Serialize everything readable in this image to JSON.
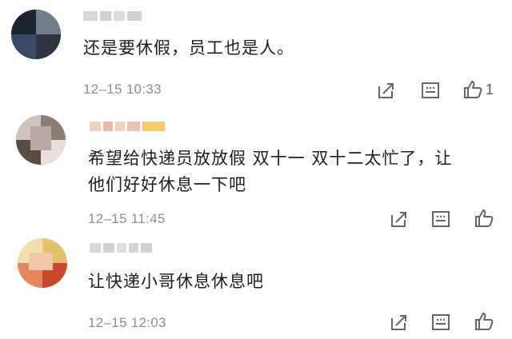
{
  "comments": [
    {
      "username": "",
      "text": "还是要休假，员工也是人。",
      "time": "12–15 10:33",
      "likes": "1",
      "avatar_colors": [
        "#2f3440",
        "#1b2330",
        "#6f7c8c",
        "#3a4a66"
      ]
    },
    {
      "username": "",
      "text_line1": "希望给快递员放放假   双十一   双十二太忙了，让",
      "text_line2": "他们好好休息一下吧",
      "time": "12–15 11:45",
      "likes": "",
      "avatar_colors": [
        "#8c7c74",
        "#cfc4bd",
        "#5d4a43",
        "#e8dfda"
      ]
    },
    {
      "username": "",
      "text": "让快递小哥休息休息吧",
      "time": "12–15 12:03",
      "likes": "",
      "avatar_colors": [
        "#e6c06b",
        "#c9462c",
        "#f1dfb2",
        "#e6845e"
      ]
    }
  ],
  "actions": {
    "share_icon": "share-icon",
    "comment_icon": "comment-icon",
    "like_icon": "thumbs-up-icon"
  },
  "colors": {
    "text": "#1e1e1e",
    "meta": "#8f8f8f",
    "icon": "#666666"
  }
}
